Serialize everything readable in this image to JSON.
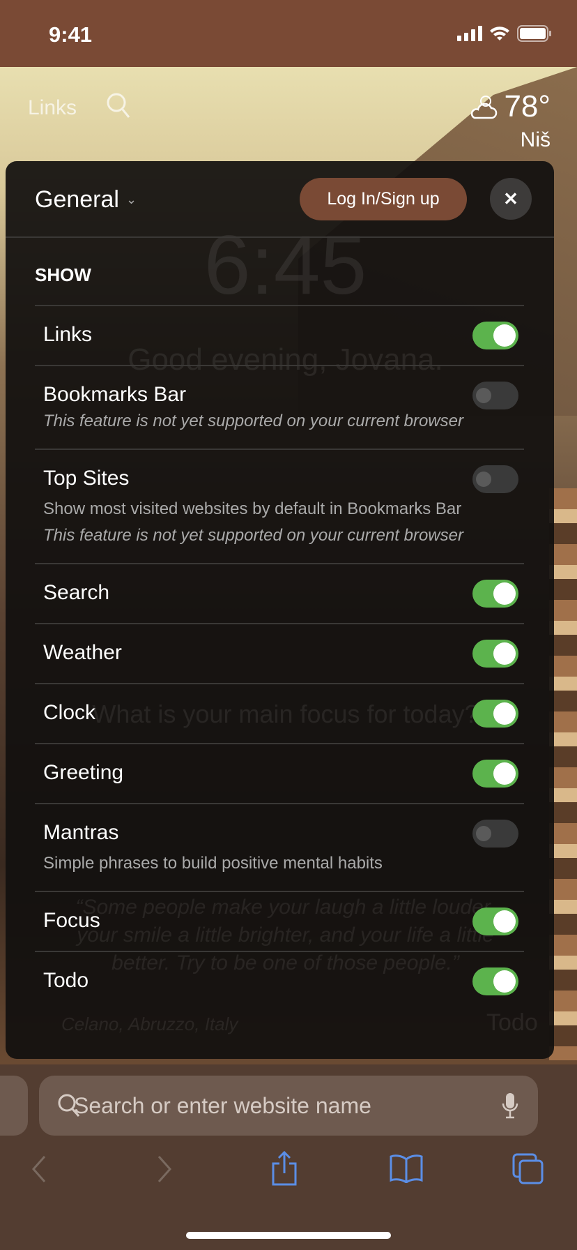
{
  "status_bar": {
    "time": "9:41"
  },
  "background": {
    "links_label": "Links",
    "weather": {
      "temperature": "78°",
      "city": "Niš",
      "icon": "partly-cloudy-icon"
    },
    "clock": "6:45",
    "greeting": "Good evening, Jovana.",
    "focus_prompt": "What is your main focus for today?",
    "quote": "“Some people make your laugh a little louder, your smile a little brighter, and your life a little better. Try to be one of those people.”",
    "location": "Celano, Abruzzo, Italy",
    "todo": "Todo"
  },
  "panel": {
    "section_selector": "General",
    "login_label": "Log In/Sign up",
    "close_icon": "✕",
    "section_heading": "SHOW",
    "items": [
      {
        "label": "Links",
        "enabled": true
      },
      {
        "label": "Bookmarks Bar",
        "enabled": false,
        "note": "This feature is not yet supported on your current browser"
      },
      {
        "label": "Top Sites",
        "enabled": false,
        "description": "Show most visited websites by default in Bookmarks Bar",
        "note": "This feature is not yet supported on your current browser"
      },
      {
        "label": "Search",
        "enabled": true
      },
      {
        "label": "Weather",
        "enabled": true
      },
      {
        "label": "Clock",
        "enabled": true
      },
      {
        "label": "Greeting",
        "enabled": true
      },
      {
        "label": "Mantras",
        "enabled": false,
        "description": "Simple phrases to build positive mental habits"
      },
      {
        "label": "Focus",
        "enabled": true
      },
      {
        "label": "Todo",
        "enabled": true
      }
    ]
  },
  "browser": {
    "search_placeholder": "Search or enter website name"
  },
  "colors": {
    "accent": "#7a4a35",
    "toggle_on": "#5cb34d",
    "toolbar_icon": "#5b8ee6"
  }
}
